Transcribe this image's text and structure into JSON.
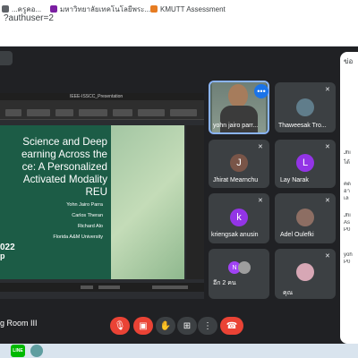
{
  "browser": {
    "url": "?authuser=2",
    "bookmarks": [
      {
        "label": "...ครูคอ...",
        "color": "#5f6368"
      },
      {
        "label": "มหาวิทยาลัยเทคโนโลยีพระ...",
        "color": "#7b1fa2"
      },
      {
        "label": "KMUTT Assessment",
        "color": "#e67c22"
      }
    ]
  },
  "presentation": {
    "window_title": "IEEE-ISSCC_Presentation",
    "title_lines": [
      "Science and Deep",
      "earning Across the",
      "ce: A Personalized",
      "Activated Modality",
      "REU"
    ],
    "authors": [
      "Yohn Jairo Parra",
      "Carlos Theran",
      "Richard Alo",
      "Florida A&M University"
    ],
    "year_fragment": "022",
    "p_fragment": "p"
  },
  "participants": [
    {
      "name": "yohn jairo parr...",
      "type": "video",
      "muted": false,
      "active": true
    },
    {
      "name": "Thaweesak Tro...",
      "type": "photo",
      "muted": true,
      "color": "#607d8b"
    },
    {
      "name": "Jhirat Mearnchu",
      "initial": "J",
      "type": "initial",
      "muted": true,
      "color": "#795548"
    },
    {
      "name": "Lay Narak",
      "initial": "L",
      "type": "initial",
      "muted": true,
      "color": "#9334e6"
    },
    {
      "name": "kriengsak anusin",
      "initial": "k",
      "type": "initial",
      "muted": true,
      "color": "#9334e6"
    },
    {
      "name": "Adel Oulefki",
      "type": "photo",
      "muted": true,
      "color": "#8d6e63"
    },
    {
      "name": "อีก 2 คน",
      "initial": "N",
      "type": "group",
      "muted": false,
      "color": "#a142f4"
    },
    {
      "name": "คุณ",
      "type": "photo",
      "muted": true,
      "color": "#d7a7b5"
    }
  ],
  "meeting": {
    "room_name": "g Room III"
  },
  "controls": {
    "mic": "mic-off-icon",
    "camera": "camera-off-icon",
    "raise_hand": "hand-icon",
    "present": "present-icon",
    "more": "more-icon",
    "hangup": "hangup-icon"
  },
  "side_panel": {
    "header": "ข่อ",
    "lines": [
      "Jhi",
      "ได้",
      "คด",
      "อา",
      "เล",
      "Jhi",
      "As",
      "P0",
      "yoh",
      "P0"
    ]
  },
  "taskbar": {
    "line_label": "LINE"
  }
}
